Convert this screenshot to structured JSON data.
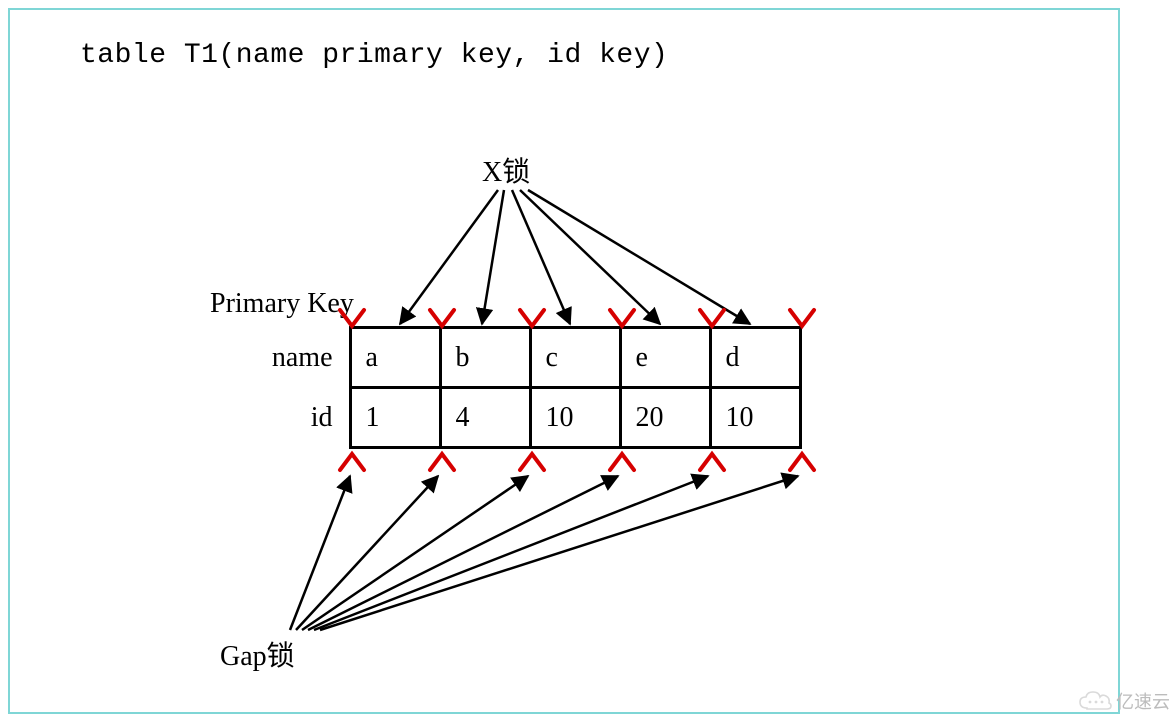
{
  "title": "table T1(name primary key, id key)",
  "labels": {
    "x_lock": "X锁",
    "primary_key": "Primary Key",
    "gap_lock": "Gap锁",
    "row_name": "name",
    "row_id": "id"
  },
  "table": {
    "name_row": [
      "a",
      "b",
      "c",
      "e",
      "d"
    ],
    "id_row": [
      "1",
      "4",
      "10",
      "20",
      "10"
    ]
  },
  "watermark": "亿速云",
  "chart_data": {
    "type": "table",
    "title": "table T1(name primary key, id key)",
    "columns": [
      "name",
      "id"
    ],
    "rows": [
      {
        "name": "a",
        "id": 1
      },
      {
        "name": "b",
        "id": 4
      },
      {
        "name": "c",
        "id": 10
      },
      {
        "name": "e",
        "id": 20
      },
      {
        "name": "d",
        "id": 10
      }
    ],
    "annotations": {
      "x_locks_on": "each record (all 5 rows) — X锁",
      "gap_locks_on": "gaps between records (6 gaps) — Gap锁",
      "primary_key": "name",
      "secondary_key": "id"
    }
  }
}
